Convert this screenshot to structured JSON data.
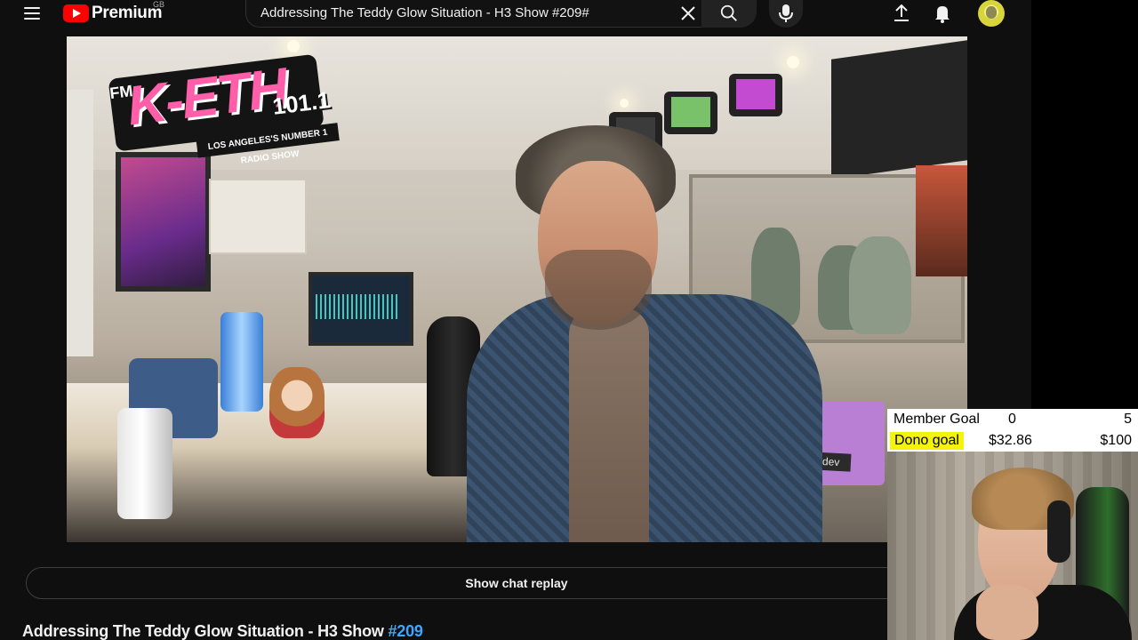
{
  "header": {
    "logo_text": "Premium",
    "country_code": "GB",
    "search_value": "Addressing The Teddy Glow Situation - H3 Show #209#",
    "icons": [
      "menu-icon",
      "youtube-logo-icon",
      "close-icon",
      "search-icon",
      "microphone-icon",
      "upload-icon",
      "bell-icon",
      "avatar"
    ]
  },
  "player": {
    "overlay_logo": {
      "fm": "FM",
      "name": "K-ETH",
      "frequency": "101.1",
      "tagline": "LOS ANGELES'S NUMBER 1 RADIO SHOW"
    },
    "sticker_text": "act.dev"
  },
  "below_player": {
    "chat_replay_label": "Show chat replay",
    "title_text": "Addressing The Teddy Glow Situation - H3 Show ",
    "title_hashtag": "#209"
  },
  "stream_overlay": {
    "member_goal": {
      "label": "Member Goal",
      "current": "0",
      "target": "5"
    },
    "dono_goal": {
      "label": "Dono goal",
      "current": "$32.86",
      "target": "$100"
    }
  },
  "colors": {
    "background": "#0f0f0f",
    "brand_red": "#ff0000",
    "hashtag_blue": "#3ea6ff",
    "dono_highlight": "#f4f30b"
  }
}
